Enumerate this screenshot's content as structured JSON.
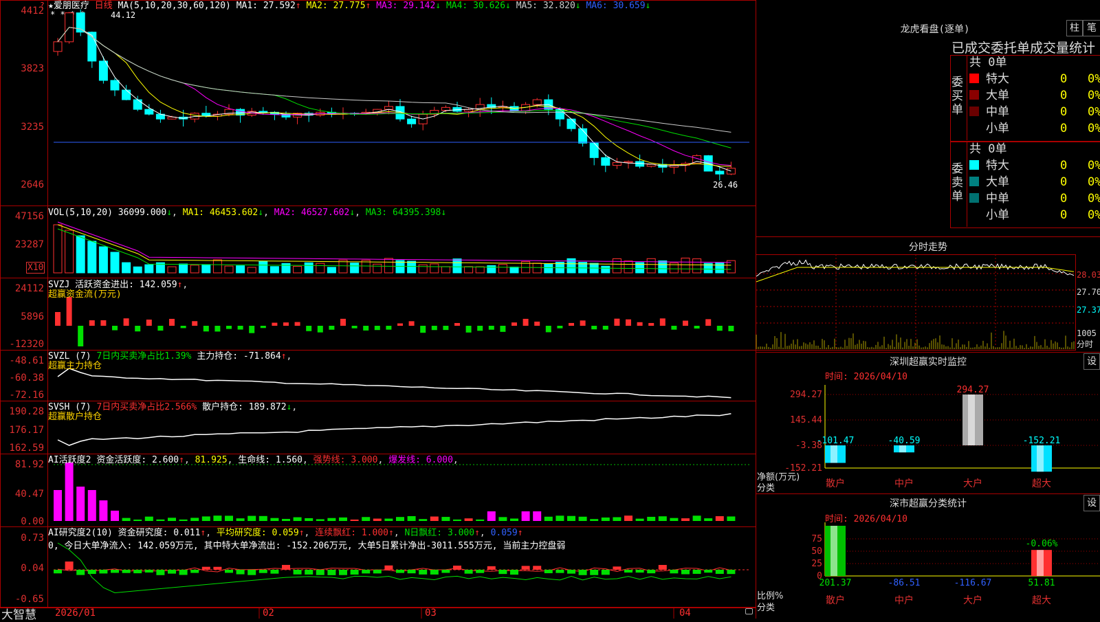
{
  "main": {
    "header": {
      "name": "★爱朋医疗",
      "period": "日线",
      "ma_label": "MA(5,10,20,30,60,120)",
      "ma": [
        {
          "t": "MA1: 27.592",
          "arrow": "↑",
          "color": "#ffffff"
        },
        {
          "t": "MA2: 27.775",
          "arrow": "↑",
          "color": "#ffff00"
        },
        {
          "t": "MA3: 29.142",
          "arrow": "↓",
          "color": "#ff00ff"
        },
        {
          "t": "MA4: 30.626",
          "arrow": "↓",
          "color": "#00e000"
        },
        {
          "t": "MA5: 32.820",
          "arrow": "↓",
          "color": "#cccccc"
        },
        {
          "t": "MA6: 30.659",
          "arrow": "↓",
          "color": "#3060ff"
        }
      ]
    },
    "y_labels": [
      "4412",
      "3823",
      "3235",
      "2646"
    ],
    "high_label": "44.12",
    "low_label": "26.46",
    "star_marks": "* * * *"
  },
  "vol": {
    "header": {
      "name": "VOL(5,10,20)",
      "v": "36099.000",
      "ma1": "MA1: 46453.602",
      "ma2": "MA2: 46527.602",
      "ma3": "MA3: 64395.398"
    },
    "y_labels": [
      "47156",
      "23287"
    ],
    "unit": "X10"
  },
  "svzj": {
    "header": {
      "name": "SVZJ",
      "t1": "活跃资金进出: 142.059",
      "arrow": "↑",
      ",": ","
    },
    "sub": "超赢资金流(万元)",
    "y_labels": [
      "24112",
      "5896",
      "-12320"
    ]
  },
  "svzl": {
    "header": {
      "name": "SVZL (7)",
      "t1": "7日内买卖净占比1.39%",
      "t2": "主力持仓: -71.864",
      "arrow": "↑"
    },
    "sub": "超赢主力持仓",
    "y_labels": [
      "-48.61",
      "-60.38",
      "-72.16"
    ]
  },
  "svsh": {
    "header": {
      "name": "SVSH (7)",
      "t1": "7日内买卖净占比2.566%",
      "t2": "散户持仓: 189.872",
      "arrow": "↓"
    },
    "sub": "超赢散户持仓",
    "y_labels": [
      "190.28",
      "176.17",
      "162.59"
    ]
  },
  "ai1": {
    "header": {
      "name": "AI活跃度2",
      "t1": "资金活跃度: 2.600",
      "a1": "↑",
      "t2": "81.925",
      "t3": "生命线: 1.560",
      "t4": "强势线: 3.000",
      "t5": "爆发线: 6.000"
    },
    "y_labels": [
      "81.92",
      "40.47",
      "0.00"
    ]
  },
  "ai2": {
    "header": {
      "name": "AI研究度2(10)",
      "t1": "资金研究度: 0.011",
      "t2": "平均研究度: 0.059",
      "t3": "连续飘红: 1.000",
      "t4": "N日飘红: 3.000",
      "t5": "0.059"
    },
    "summary": "0, 今日大单净流入: 142.059万元, 其中特大单净流出: -152.206万元, 大单5日累计净出-3011.555万元, 当前主力控盘弱",
    "y_labels": [
      "0.73",
      "0.04",
      "-0.65"
    ]
  },
  "xaxis": {
    "labels": [
      "2026/01",
      "02",
      "03",
      "04"
    ]
  },
  "logo": "大智慧",
  "right": {
    "lhb": {
      "title": "龙虎看盘(逐单)",
      "tabs": [
        "柱",
        "笔"
      ],
      "subtitle": "已成交委托单成交量统计",
      "buy": {
        "side": "委买单",
        "total": "共 0单",
        "rows": [
          {
            "name": "特大",
            "v": "0",
            "p": "0%",
            "color": "#ff0000"
          },
          {
            "name": "大单",
            "v": "0",
            "p": "0%",
            "color": "#8a0000"
          },
          {
            "name": "中单",
            "v": "0",
            "p": "0%",
            "color": "#6a0000"
          },
          {
            "name": "小单",
            "v": "0",
            "p": "0%",
            "color": ""
          }
        ]
      },
      "sell": {
        "side": "委卖单",
        "total": "共 0单",
        "rows": [
          {
            "name": "特大",
            "v": "0",
            "p": "0%",
            "color": "#00ffff"
          },
          {
            "name": "大单",
            "v": "0",
            "p": "0%",
            "color": "#008080"
          },
          {
            "name": "中单",
            "v": "0",
            "p": "0%",
            "color": "#007070"
          },
          {
            "name": "小单",
            "v": "0",
            "p": "0%",
            "color": ""
          }
        ]
      }
    },
    "fs": {
      "title": "分时走势",
      "y_labels": [
        "28.03",
        "27.70",
        "27.37"
      ],
      "vol_label": "1005",
      "vol_unit": "分时"
    },
    "sz1": {
      "title": "深圳超赢实时监控",
      "settings": "设",
      "time": "时间: 2026/04/10",
      "y_labels": [
        "294.27",
        "145.44",
        "-3.38",
        "-152.21"
      ],
      "left_label1": "净额(万元)",
      "left_label2": "分类",
      "categories": [
        "散户",
        "中户",
        "大户",
        "超大"
      ],
      "values": [
        -101.47,
        -40.59,
        294.27,
        -152.21
      ],
      "value_labels": [
        "-101.47",
        "-40.59",
        "294.27",
        "-152.21"
      ]
    },
    "sz2": {
      "title": "深市超赢分类统计",
      "settings": "设",
      "time": "时间: 2026/04/10",
      "y_labels": [
        "75",
        "50",
        "25",
        "0"
      ],
      "left_label1": "比例%",
      "left_label2": "分类",
      "categories": [
        "散户",
        "中户",
        "大户",
        "超大"
      ],
      "values": [
        201.37,
        -86.51,
        -116.67,
        51.81
      ],
      "value_labels": [
        "201.37",
        "-86.51",
        "-116.67",
        "51.81"
      ],
      "top_label": "-0.06%"
    }
  }
}
